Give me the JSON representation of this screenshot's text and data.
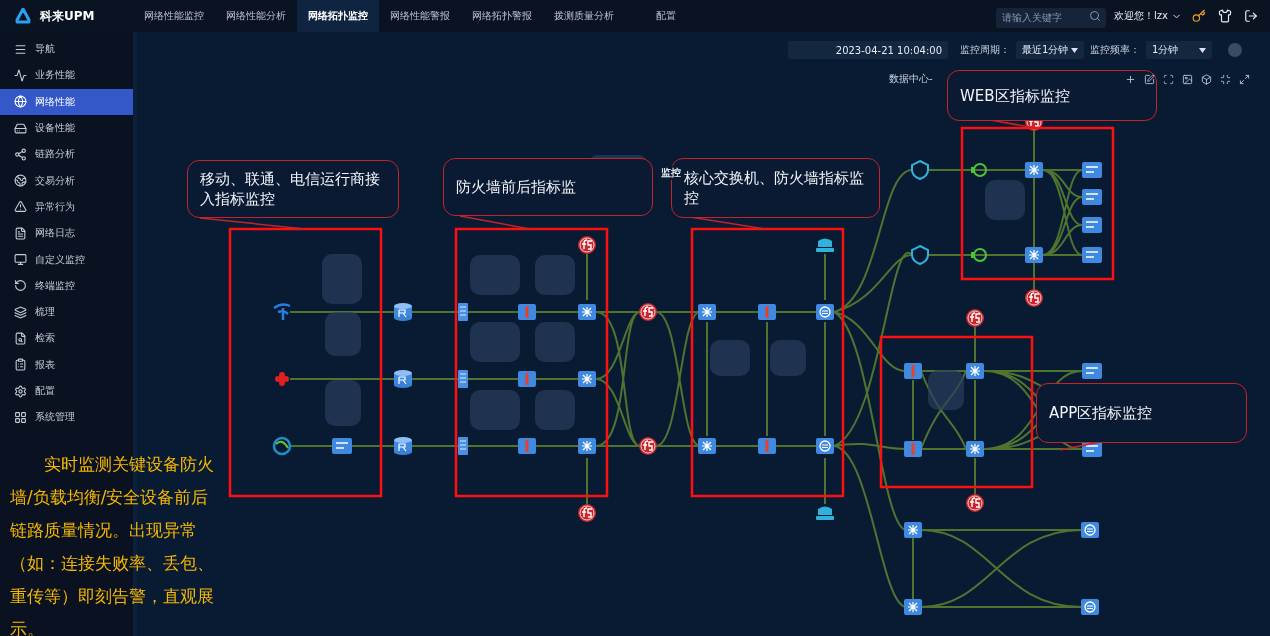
{
  "brand": "科来UPM",
  "nav_tabs": [
    {
      "label": "网络性能监控",
      "selected": false
    },
    {
      "label": "网络性能分析",
      "selected": false
    },
    {
      "label": "网络拓扑监控",
      "selected": true
    },
    {
      "label": "网络性能警报",
      "selected": false
    },
    {
      "label": "网络拓扑警报",
      "selected": false
    },
    {
      "label": "拨测质量分析",
      "selected": false
    },
    {
      "label": "配置",
      "selected": false
    }
  ],
  "search": {
    "placeholder": "请输入关键字"
  },
  "user": "欢迎您！lzx",
  "sidebar": {
    "items": [
      {
        "label": "导航",
        "selected": false
      },
      {
        "label": "业务性能",
        "selected": false
      },
      {
        "label": "网络性能",
        "selected": true
      },
      {
        "label": "设备性能",
        "selected": false
      },
      {
        "label": "链路分析",
        "selected": false
      },
      {
        "label": "交易分析",
        "selected": false
      },
      {
        "label": "异常行为",
        "selected": false
      },
      {
        "label": "网络日志",
        "selected": false
      },
      {
        "label": "自定义监控",
        "selected": false
      },
      {
        "label": "终端监控",
        "selected": false
      },
      {
        "label": "梳理",
        "selected": false
      },
      {
        "label": "检索",
        "selected": false
      },
      {
        "label": "报表",
        "selected": false
      },
      {
        "label": "配置",
        "selected": false
      },
      {
        "label": "系统管理",
        "selected": false
      }
    ]
  },
  "toolbar": {
    "time": "2023-04-21 10:04:00",
    "period_label": "监控周期：",
    "period": "最近1分钟",
    "rate_label": "监控频率：",
    "rate": "1分钟"
  },
  "breadcrumb": "数据中心-",
  "side_label": "监控",
  "callouts": [
    "移动、联通、电信运行商接入指标监控",
    "防火墙前后指标监",
    "核心交换机、防火墙指标监控",
    "WEB区指标监控",
    "APP区指标监控"
  ],
  "note": "实时监测关键设备防火墙/负载均衡/安全设备前后链路质量情况。出现异常（如：连接失败率、丢包、重传等）即刻告警，直观展示。"
}
